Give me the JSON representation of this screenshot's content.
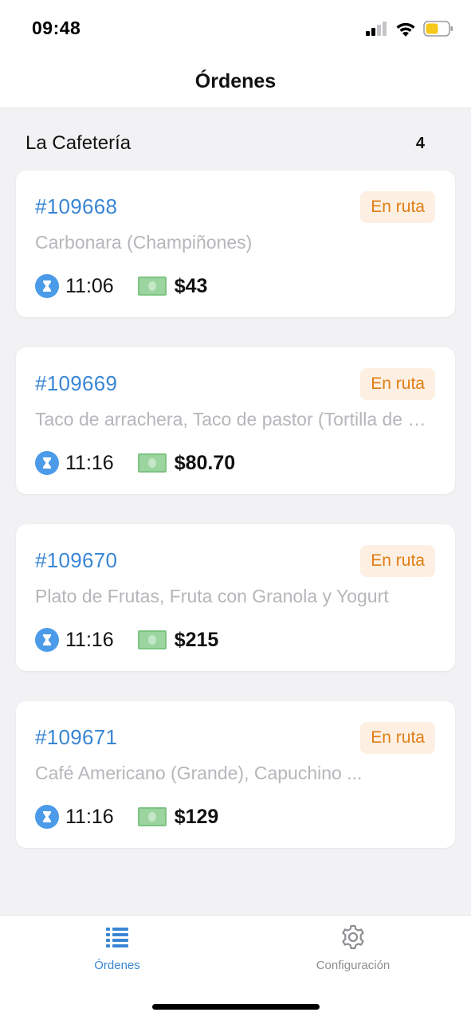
{
  "status_bar": {
    "time": "09:48"
  },
  "header": {
    "title": "Órdenes"
  },
  "section": {
    "title": "La Cafetería",
    "count": "4"
  },
  "orders": [
    {
      "id": "#109668",
      "status": "En ruta",
      "items": "Carbonara (Champiñones)",
      "time": "11:06",
      "total": "$43"
    },
    {
      "id": "#109669",
      "status": "En ruta",
      "items": "Taco de arrachera, Taco de pastor (Tortilla de maíz)",
      "time": "11:16",
      "total": "$80.70"
    },
    {
      "id": "#109670",
      "status": "En ruta",
      "items": "Plato de Frutas, Fruta con Granola y Yogurt",
      "time": "11:16",
      "total": "$215"
    },
    {
      "id": "#109671",
      "status": "En ruta",
      "items": "Café Americano (Grande), Capuchino ...",
      "time": "11:16",
      "total": "$129"
    }
  ],
  "tab_bar": {
    "tabs": [
      {
        "label": "Órdenes",
        "icon": "list-icon",
        "active": true
      },
      {
        "label": "Configuración",
        "icon": "gear-icon",
        "active": false
      }
    ]
  },
  "colors": {
    "accent": "#3a86d4",
    "status_badge_bg": "#fdf0e3",
    "status_badge_text": "#e07d14",
    "background": "#f2f2f4"
  }
}
